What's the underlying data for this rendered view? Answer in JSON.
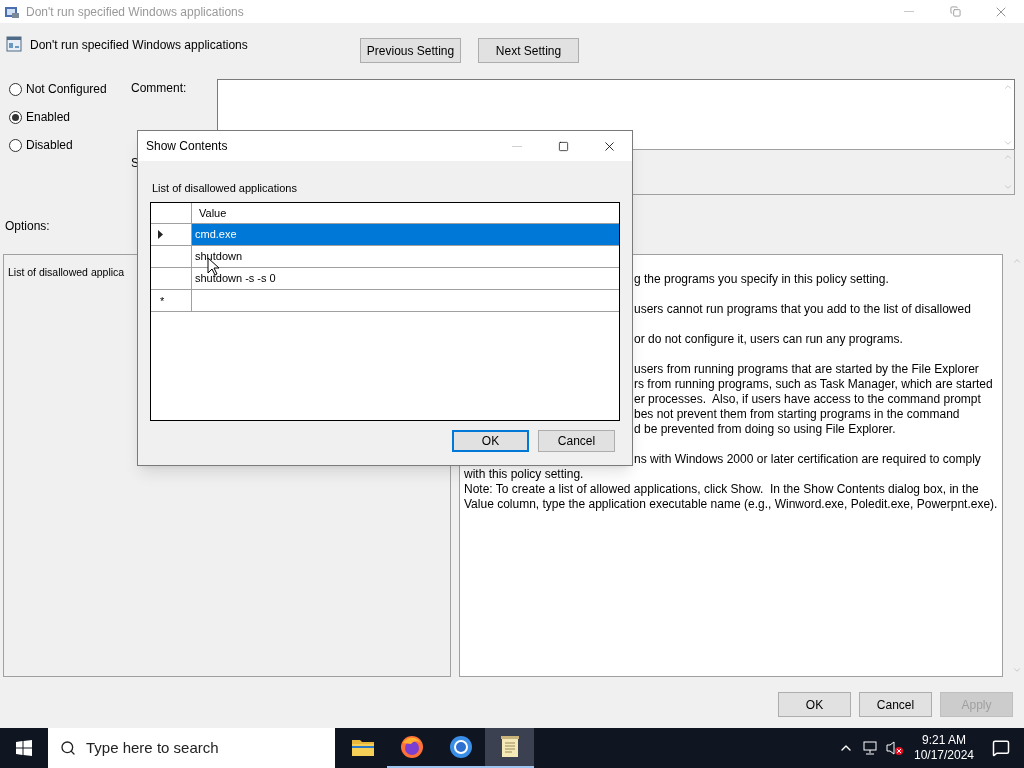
{
  "window": {
    "title": "Don't run specified Windows applications"
  },
  "policy": {
    "name": "Don't run specified Windows applications"
  },
  "nav_buttons": [
    "Previous Setting",
    "Next Setting"
  ],
  "state_options": [
    {
      "label": "Not Configured",
      "selected": false
    },
    {
      "label": "Enabled",
      "selected": true
    },
    {
      "label": "Disabled",
      "selected": false
    }
  ],
  "comment": {
    "label": "Comment:"
  },
  "supported": {
    "label": "S"
  },
  "options": {
    "label": "Options:",
    "text": "List of disallowed applica"
  },
  "help": {
    "paragraphs": [
      [
        {
          "text": "g the programs you specify in this policy setting.",
          "covered": true
        }
      ],
      [
        {
          "text": "users cannot run programs that you add to the list of disallowed",
          "covered": true
        }
      ],
      [
        {
          "text": "or do not configure it, users can run any programs.",
          "covered": true
        }
      ],
      [
        {
          "text": "users from running programs that are started by the File Explorer",
          "covered": true
        },
        {
          "text": "rs from running programs, such as Task Manager, which are started",
          "covered": true
        },
        {
          "text": "er processes.  Also, if users have access to the command prompt",
          "covered": true
        },
        {
          "text": "bes not prevent them from starting programs in the command",
          "covered": true
        },
        {
          "text": "d be prevented from doing so using File Explorer.",
          "covered": true
        }
      ],
      [
        {
          "text": "ns with Windows 2000 or later certification are required to comply",
          "covered": true
        },
        {
          "text": "with this policy setting.",
          "covered": false
        },
        {
          "text": "Note: To create a list of allowed applications, click Show.  In the Show Contents dialog box, in the",
          "covered": false
        },
        {
          "text": "Value column, type the application executable name (e.g., Winword.exe, Poledit.exe, Powerpnt.exe).",
          "covered": false
        }
      ]
    ]
  },
  "footer_buttons": [
    {
      "label": "OK",
      "disabled": false
    },
    {
      "label": "Cancel",
      "disabled": false
    },
    {
      "label": "Apply",
      "disabled": true
    }
  ],
  "dialog": {
    "title": "Show Contents",
    "caption": "List of disallowed applications",
    "column": "Value",
    "rows": [
      {
        "value": "cmd.exe",
        "selected": true
      },
      {
        "value": "shutdown",
        "selected": false
      },
      {
        "value": "shutdown -s -s 0",
        "selected": false
      }
    ],
    "new_row_marker": "*",
    "buttons": [
      {
        "label": "OK",
        "default": true
      },
      {
        "label": "Cancel",
        "default": false
      }
    ]
  },
  "taskbar": {
    "search_placeholder": "Type here to search",
    "apps": [
      {
        "kind": "folder",
        "open": false,
        "active": false
      },
      {
        "kind": "firefox",
        "open": true,
        "active": false
      },
      {
        "kind": "chrome",
        "open": true,
        "active": false
      },
      {
        "kind": "notepad",
        "open": true,
        "active": true
      }
    ],
    "time": "9:21 AM",
    "date": "10/17/2024"
  }
}
